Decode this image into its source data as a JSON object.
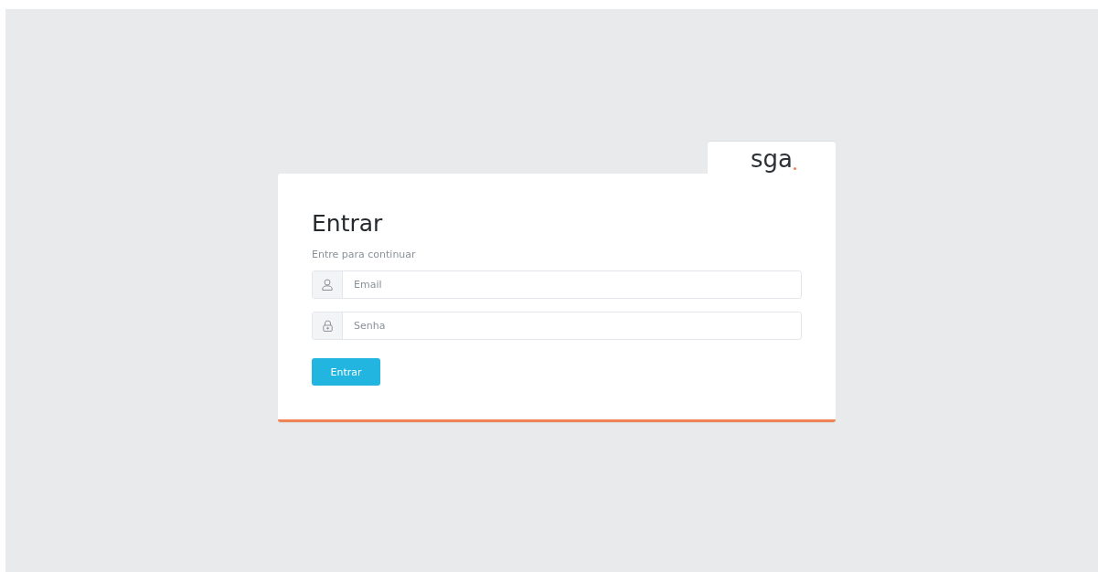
{
  "logo": {
    "text": "sga"
  },
  "title": "Entrar",
  "subtitle": "Entre para continuar",
  "fields": [
    {
      "kind": "user",
      "placeholder": "Email"
    },
    {
      "kind": "lock",
      "placeholder": "Senha"
    }
  ],
  "button": "Entrar"
}
